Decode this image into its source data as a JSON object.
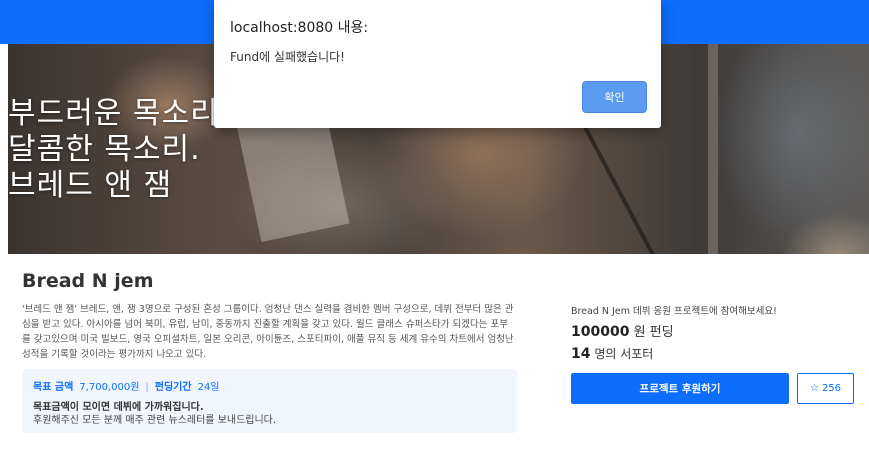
{
  "hero": {
    "lines": [
      "부드러운 목소리",
      "달콤한 목소리.",
      "브레드 앤 잼"
    ]
  },
  "project": {
    "title": "Bread N jem",
    "description": "'브레드 앤 잼' 브레드, 앤, 잼 3명으로 구성된 혼성 그룹이다. 엄청난 댄스 실력을 겸비한 멤버 구성으로, 데뷔 전부터 많은 관심을 받고 있다. 아시아를 넘어 북미, 유럽, 남미, 중동까지 진출할 계획을 갖고 있다. 월드 클래스 슈퍼스타가 되겠다는 포부를 갖고있으며 미국 빌보드, 영국 오피셜차트, 일본 오리콘, 아이튠즈, 스포티파이, 애플 뮤직 등 세계 유수의 차트에서 엄청난 성적을 기록할 것이라는 평가까지 나오고 있다.",
    "goal_label": "목표 금액",
    "goal_value": "7,700,000원",
    "period_label": "펀딩기간",
    "period_value": "24일",
    "note_bold": "목표금액이 모이면 데뷔에 가까워집니다.",
    "note": "후원해주신 모든 분께 매주 관련 뉴스레터를 보내드립니다."
  },
  "sidebar": {
    "cta": "Bread N Jem 데뷔 응원 프로젝트에 참여해보세요!",
    "amount_value": "100000",
    "amount_unit": "원 펀딩",
    "supporters_value": "14",
    "supporters_unit": "명의 서포터",
    "support_button": "프로젝트 후원하기",
    "like_count": "256",
    "like_icon": "star-outline-icon"
  },
  "dialog": {
    "title": "localhost:8080 내용:",
    "message": "Fund에 실패했습니다!",
    "ok_label": "확인"
  },
  "colors": {
    "primary": "#0d6efd",
    "info_bg": "#f1f6fd",
    "dialog_button": "#5b9bf0"
  }
}
